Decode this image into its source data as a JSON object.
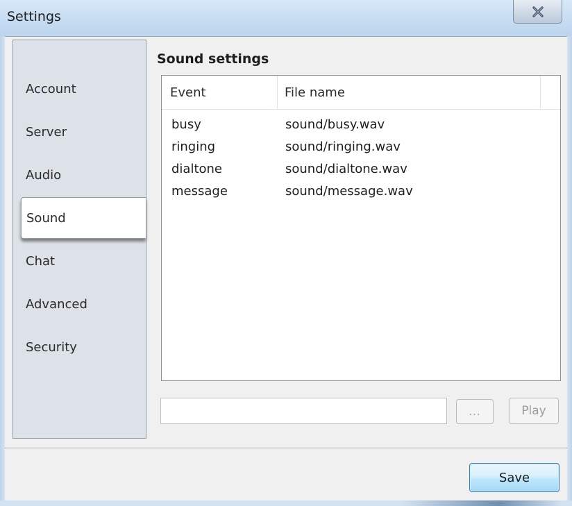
{
  "window": {
    "title": "Settings",
    "close_icon": "close-icon"
  },
  "sidebar": {
    "items": [
      {
        "label": "Account"
      },
      {
        "label": "Server"
      },
      {
        "label": "Audio"
      },
      {
        "label": "Sound",
        "selected": true
      },
      {
        "label": "Chat"
      },
      {
        "label": "Advanced"
      },
      {
        "label": "Security"
      }
    ]
  },
  "sound_settings": {
    "title": "Sound settings",
    "columns": [
      "Event",
      "File name"
    ],
    "rows": [
      {
        "event": "busy",
        "file": "sound/busy.wav"
      },
      {
        "event": "ringing",
        "file": "sound/ringing.wav"
      },
      {
        "event": "dialtone",
        "file": "sound/dialtone.wav"
      },
      {
        "event": "message",
        "file": "sound/message.wav"
      }
    ],
    "path_value": "",
    "browse_label": "...",
    "play_label": "Play"
  },
  "footer": {
    "save_label": "Save"
  },
  "colors": {
    "titlebar": "#c6dcf2",
    "sidebar_bg": "#dde2e8",
    "save_accent": "#3c7fb1"
  }
}
